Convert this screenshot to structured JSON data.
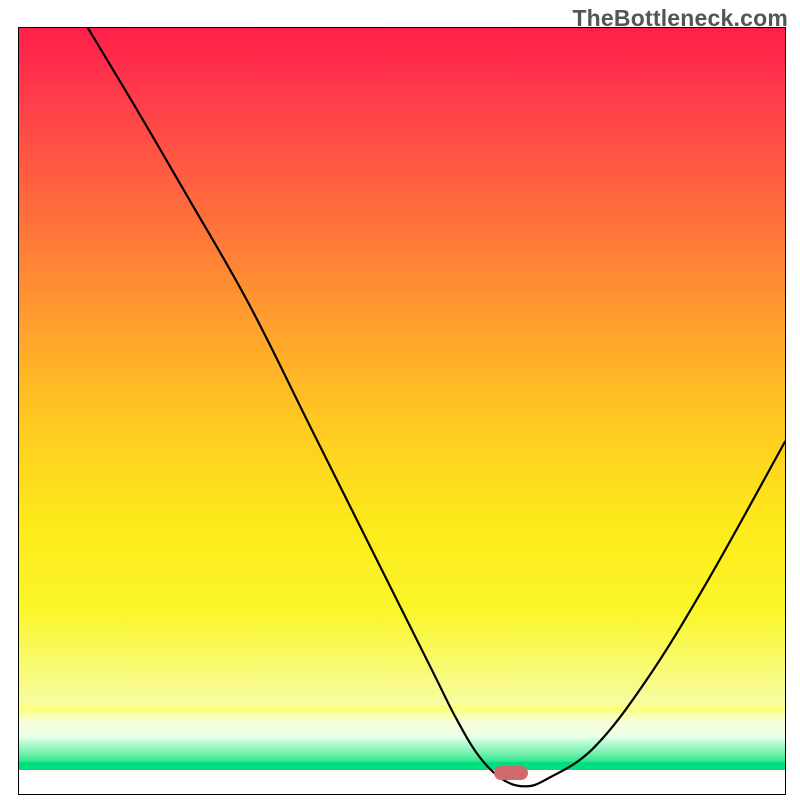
{
  "watermark": "TheBottleneck.com",
  "chart_data": {
    "type": "line",
    "title": "",
    "xlabel": "",
    "ylabel": "",
    "xlim": [
      0,
      100
    ],
    "ylim": [
      0,
      100
    ],
    "grid": false,
    "legend": false,
    "series": [
      {
        "name": "bottleneck-curve",
        "x": [
          9,
          15,
          22,
          30,
          38,
          46,
          54,
          57,
          60,
          63,
          66,
          69,
          75,
          82,
          90,
          100
        ],
        "y": [
          100,
          90,
          78,
          64,
          48,
          32,
          16,
          10,
          5,
          2,
          1,
          2,
          6,
          15,
          28,
          46
        ]
      }
    ],
    "marker": {
      "x": 64,
      "y": 3,
      "color": "#cf6b6c"
    },
    "gradient_stops": [
      {
        "pos": 0,
        "color": "#ff1f4a"
      },
      {
        "pos": 55,
        "color": "#ffd022"
      },
      {
        "pos": 92,
        "color": "#f7ffdb"
      },
      {
        "pos": 97,
        "color": "#00df80"
      },
      {
        "pos": 100,
        "color": "#ffffff"
      }
    ]
  }
}
